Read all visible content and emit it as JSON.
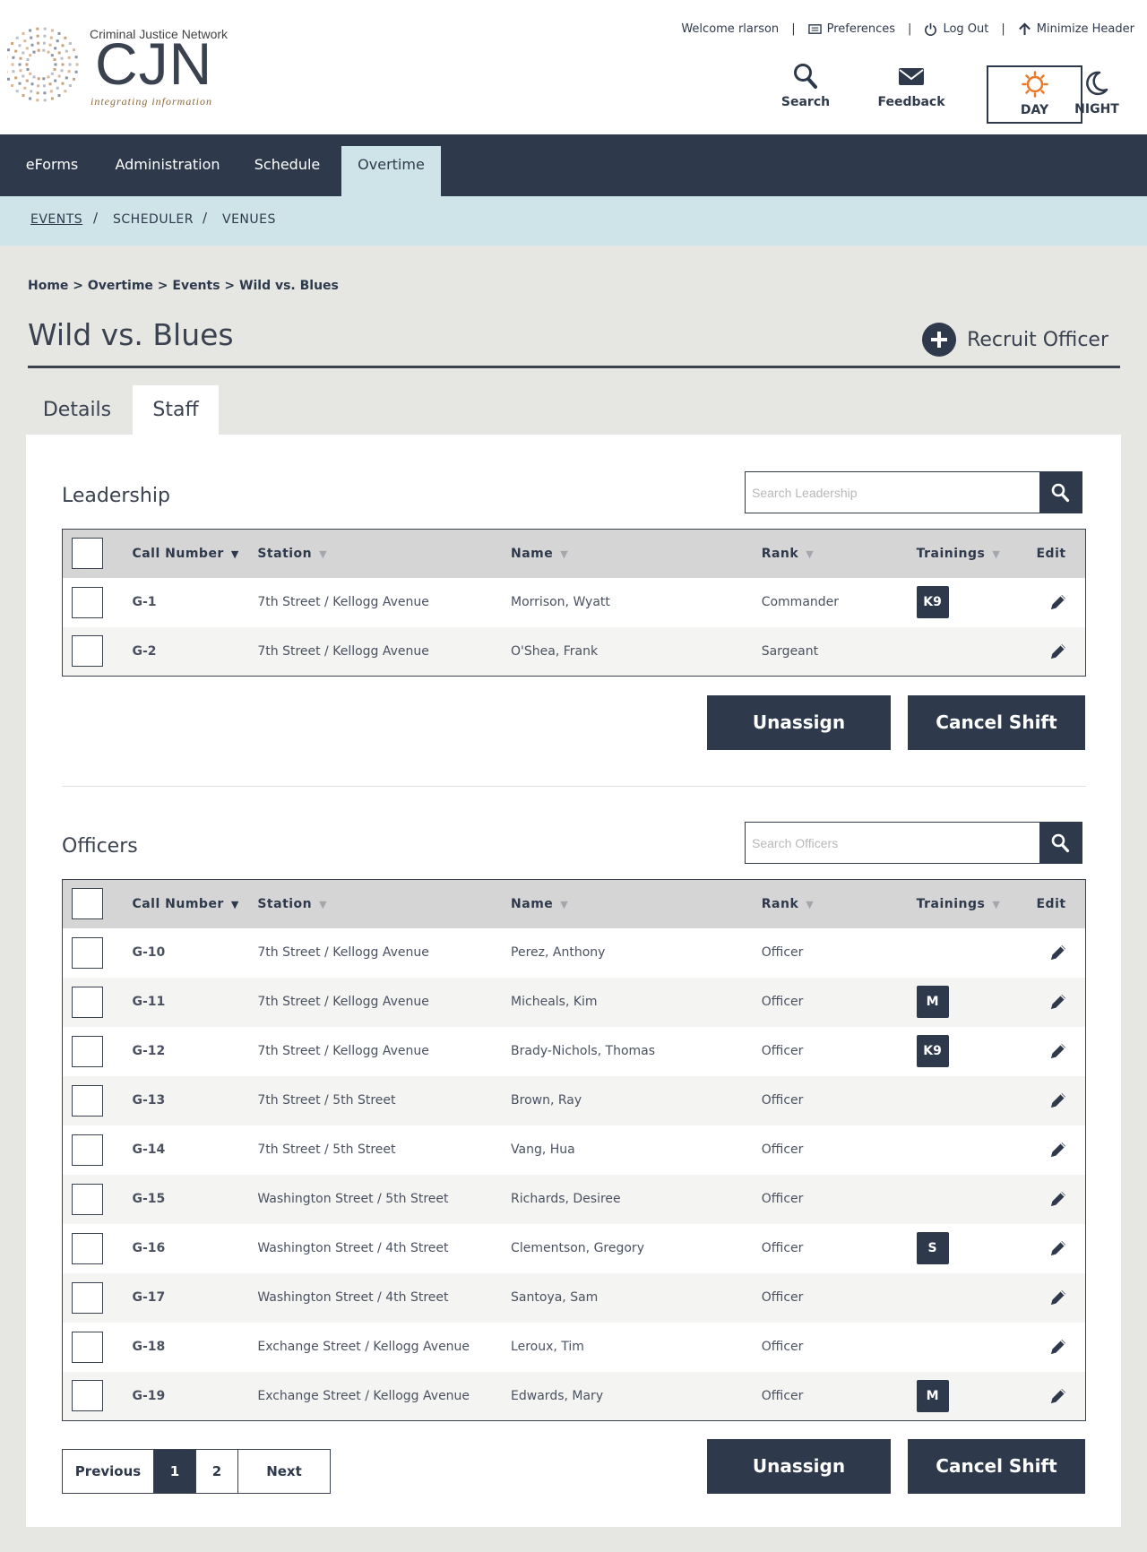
{
  "logo": {
    "small": "Criminal Justice Network",
    "big": "CJN",
    "tagline": "integrating information"
  },
  "toplinks": {
    "welcome": "Welcome rlarson",
    "preferences": "Preferences",
    "logout": "Log Out",
    "minimize": "Minimize Header"
  },
  "header_buttons": {
    "search": "Search",
    "feedback": "Feedback",
    "day": "DAY",
    "night": "NIGHT"
  },
  "nav": [
    "eForms",
    "Administration",
    "Schedule",
    "Overtime"
  ],
  "subnav": [
    "EVENTS",
    "SCHEDULER",
    "VENUES"
  ],
  "breadcrumb": "Home > Overtime > Events > Wild vs. Blues",
  "page_title": "Wild vs. Blues",
  "recruit_label": "Recruit Officer",
  "tabs": [
    "Details",
    "Staff"
  ],
  "columns": [
    "Call Number",
    "Station",
    "Name",
    "Rank",
    "Trainings",
    "Edit"
  ],
  "leadership": {
    "title": "Leadership",
    "search_placeholder": "Search Leadership",
    "rows": [
      {
        "call": "G-1",
        "station": "7th Street / Kellogg Avenue",
        "name": "Morrison, Wyatt",
        "rank": "Commander",
        "training": "K9"
      },
      {
        "call": "G-2",
        "station": "7th Street / Kellogg Avenue",
        "name": "O'Shea, Frank",
        "rank": "Sargeant",
        "training": ""
      }
    ]
  },
  "officers": {
    "title": "Officers",
    "search_placeholder": "Search Officers",
    "rows": [
      {
        "call": "G-10",
        "station": "7th Street / Kellogg Avenue",
        "name": "Perez, Anthony",
        "rank": "Officer",
        "training": ""
      },
      {
        "call": "G-11",
        "station": "7th Street / Kellogg Avenue",
        "name": "Micheals, Kim",
        "rank": "Officer",
        "training": "M"
      },
      {
        "call": "G-12",
        "station": "7th Street / Kellogg Avenue",
        "name": "Brady-Nichols, Thomas",
        "rank": "Officer",
        "training": "K9"
      },
      {
        "call": "G-13",
        "station": "7th Street / 5th Street",
        "name": "Brown, Ray",
        "rank": "Officer",
        "training": ""
      },
      {
        "call": "G-14",
        "station": "7th Street / 5th Street",
        "name": "Vang, Hua",
        "rank": "Officer",
        "training": ""
      },
      {
        "call": "G-15",
        "station": "Washington Street / 5th Street",
        "name": "Richards, Desiree",
        "rank": "Officer",
        "training": ""
      },
      {
        "call": "G-16",
        "station": "Washington Street / 4th Street",
        "name": "Clementson, Gregory",
        "rank": "Officer",
        "training": "S"
      },
      {
        "call": "G-17",
        "station": "Washington Street / 4th Street",
        "name": "Santoya, Sam",
        "rank": "Officer",
        "training": ""
      },
      {
        "call": "G-18",
        "station": "Exchange Street / Kellogg Avenue",
        "name": "Leroux, Tim",
        "rank": "Officer",
        "training": ""
      },
      {
        "call": "G-19",
        "station": "Exchange Street / Kellogg Avenue",
        "name": "Edwards, Mary",
        "rank": "Officer",
        "training": "M"
      }
    ]
  },
  "actions": {
    "unassign": "Unassign",
    "cancel_shift": "Cancel Shift"
  },
  "pager": {
    "previous": "Previous",
    "pages": [
      "1",
      "2"
    ],
    "next": "Next",
    "current": "1"
  },
  "colors": {
    "navy": "#2e3a4c",
    "light_teal": "#cfe4e8",
    "day_icon": "#e8782a"
  },
  "icons": [
    "search-icon",
    "envelope-icon",
    "sun-icon",
    "moon-icon",
    "preferences-icon",
    "power-icon",
    "arrow-up-icon",
    "plus-icon",
    "pencil-icon"
  ]
}
